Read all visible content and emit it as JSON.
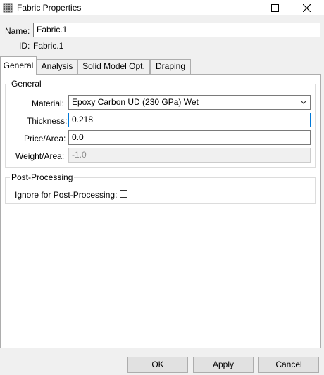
{
  "window": {
    "title": "Fabric Properties",
    "app_icon": "fabric-grid-icon",
    "controls": [
      "minimize-icon",
      "maximize-icon",
      "close-icon"
    ]
  },
  "header": {
    "name_label": "Name:",
    "name_value": "Fabric.1",
    "id_label": "ID:",
    "id_value": "Fabric.1"
  },
  "tabs": [
    {
      "label": "General",
      "active": true
    },
    {
      "label": "Analysis",
      "active": false
    },
    {
      "label": "Solid Model Opt.",
      "active": false
    },
    {
      "label": "Draping",
      "active": false
    }
  ],
  "general_group": {
    "title": "General",
    "material_label": "Material:",
    "material_value": "Epoxy Carbon UD (230 GPa) Wet",
    "thickness_label": "Thickness:",
    "thickness_value": "0.218",
    "price_label": "Price/Area:",
    "price_value": "0.0",
    "weight_label": "Weight/Area:",
    "weight_value": "-1.0"
  },
  "postprocessing_group": {
    "title": "Post-Processing",
    "ignore_label": "Ignore for Post-Processing:",
    "ignore_checked": false
  },
  "buttons": {
    "ok": "OK",
    "apply": "Apply",
    "cancel": "Cancel"
  },
  "colors": {
    "focus_border": "#0078d7",
    "panel_bg": "#ffffff",
    "window_bg": "#f0f0f0"
  }
}
